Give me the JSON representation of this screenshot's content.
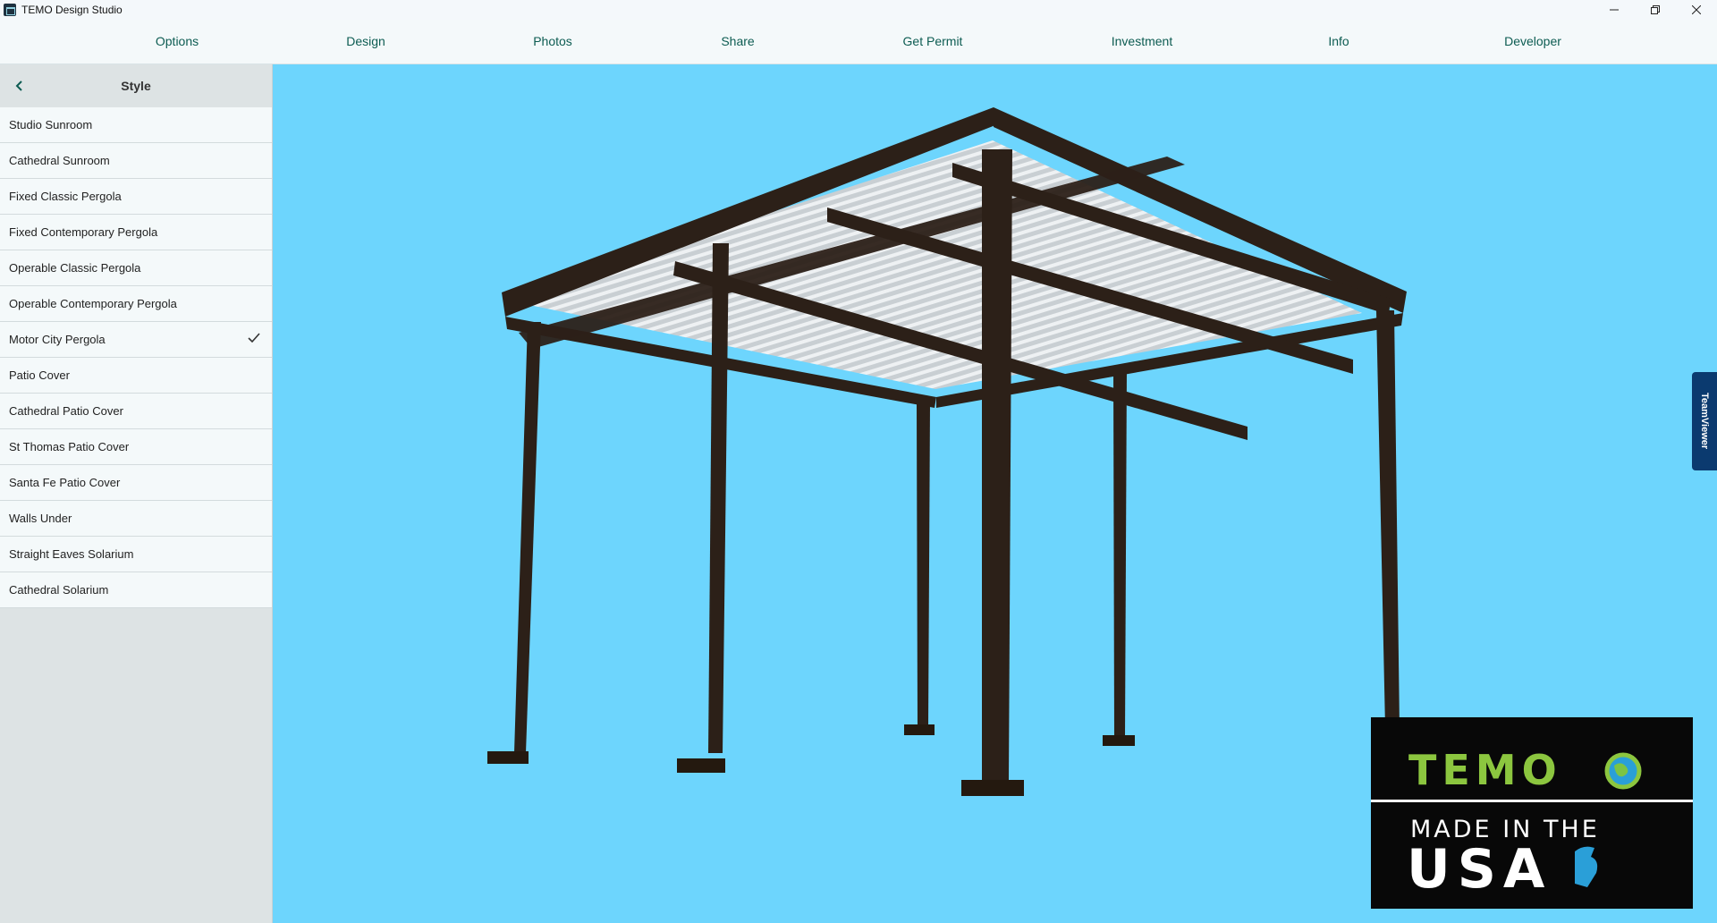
{
  "window": {
    "title": "TEMO Design Studio",
    "controls": {
      "minimize": "—",
      "restore": "❐",
      "close": "✕"
    }
  },
  "nav": {
    "items": [
      {
        "label": "Options"
      },
      {
        "label": "Design"
      },
      {
        "label": "Photos"
      },
      {
        "label": "Share"
      },
      {
        "label": "Get Permit"
      },
      {
        "label": "Investment"
      },
      {
        "label": "Info"
      },
      {
        "label": "Developer"
      }
    ]
  },
  "sidebar": {
    "back_icon": "chevron-left-icon",
    "title": "Style",
    "selected_index": 6,
    "items": [
      {
        "label": "Studio Sunroom"
      },
      {
        "label": "Cathedral Sunroom"
      },
      {
        "label": "Fixed Classic Pergola"
      },
      {
        "label": "Fixed Contemporary Pergola"
      },
      {
        "label": "Operable Classic Pergola"
      },
      {
        "label": "Operable Contemporary Pergola"
      },
      {
        "label": "Motor City Pergola"
      },
      {
        "label": "Patio Cover"
      },
      {
        "label": "Cathedral Patio Cover"
      },
      {
        "label": "St Thomas Patio Cover"
      },
      {
        "label": "Santa Fe Patio Cover"
      },
      {
        "label": "Walls Under"
      },
      {
        "label": "Straight Eaves Solarium"
      },
      {
        "label": "Cathedral Solarium"
      }
    ]
  },
  "viewport": {
    "background_color": "#6dd5fd",
    "structure_color": "#2c2018",
    "louver_color": "#d9dde0"
  },
  "teamviewer": {
    "label": "TeamViewer"
  },
  "logo": {
    "brand": "TEMO",
    "line1": "MADE IN THE",
    "line2": "USA",
    "brand_color": "#8cc63f"
  }
}
